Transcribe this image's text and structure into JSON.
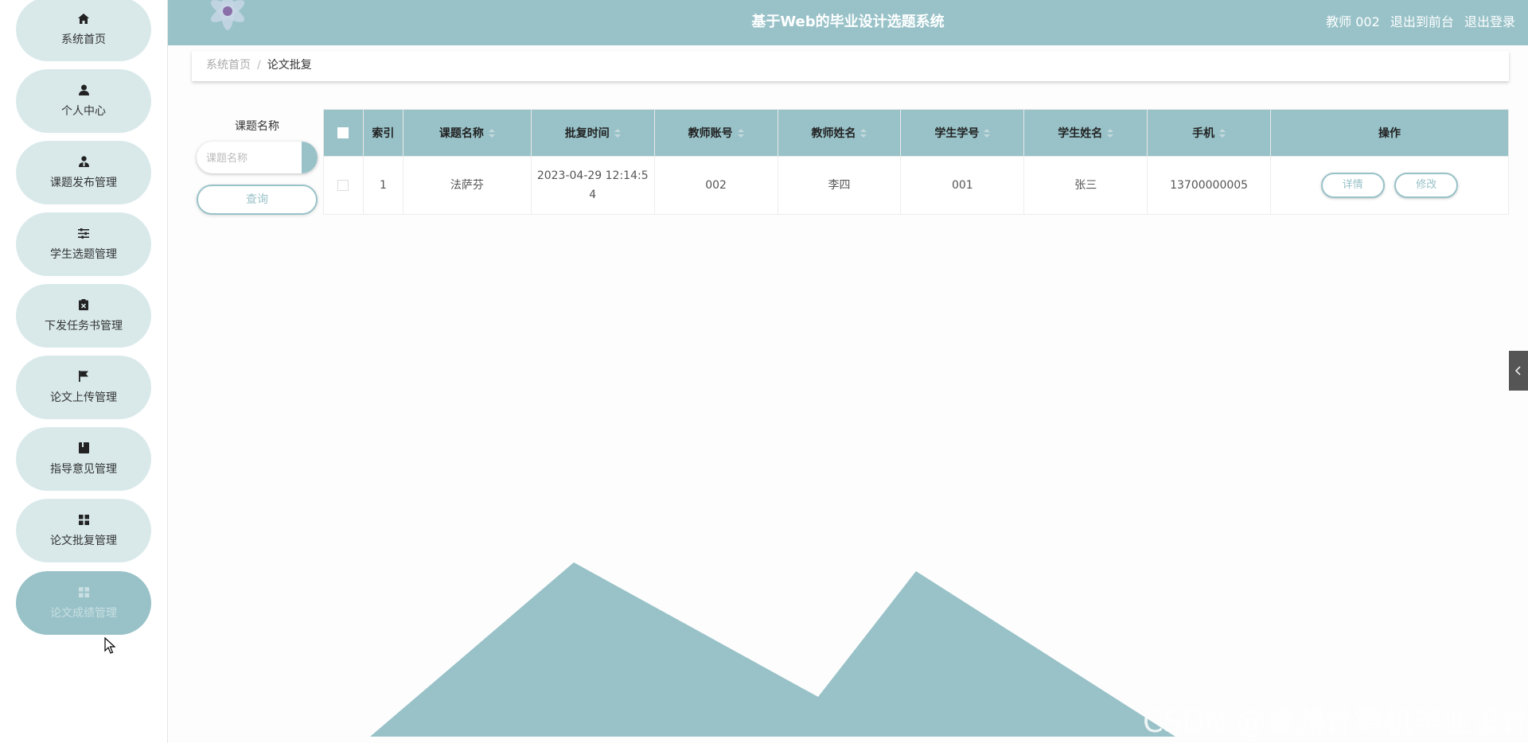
{
  "header": {
    "title": "基于Web的毕业设计选题系统",
    "user": "教师 002",
    "link_front": "退出到前台",
    "link_logout": "退出登录"
  },
  "sidebar": {
    "items": [
      {
        "label": "系统首页",
        "icon": "home-icon"
      },
      {
        "label": "个人中心",
        "icon": "user-icon"
      },
      {
        "label": "课题发布管理",
        "icon": "user-tie-icon"
      },
      {
        "label": "学生选题管理",
        "icon": "sliders-icon"
      },
      {
        "label": "下发任务书管理",
        "icon": "clipboard-icon"
      },
      {
        "label": "论文上传管理",
        "icon": "flag-icon"
      },
      {
        "label": "指导意见管理",
        "icon": "book-icon"
      },
      {
        "label": "论文批复管理",
        "icon": "grid-icon"
      },
      {
        "label": "论文成绩管理",
        "icon": "grid-icon",
        "active": true
      }
    ]
  },
  "breadcrumb": {
    "home": "系统首页",
    "separator": "/",
    "current": "论文批复"
  },
  "search": {
    "label": "课题名称",
    "placeholder": "课题名称",
    "button": "查询"
  },
  "table": {
    "columns": [
      "索引",
      "课题名称",
      "批复时间",
      "教师账号",
      "教师姓名",
      "学生学号",
      "学生姓名",
      "手机",
      "操作"
    ],
    "rows": [
      {
        "index": "1",
        "topic": "法萨芬",
        "time_line1": "2023-04-29 12:14:5",
        "time_line2": "4",
        "teacher_account": "002",
        "teacher_name": "李四",
        "student_id": "001",
        "student_name": "张三",
        "phone": "13700000005",
        "btn_detail": "详情",
        "btn_edit": "修改"
      }
    ]
  },
  "watermark": "CSDN @睿渊计算机毕业设计",
  "colors": {
    "accent": "#98c2c8",
    "sidebar_item": "#d9e9ea"
  }
}
